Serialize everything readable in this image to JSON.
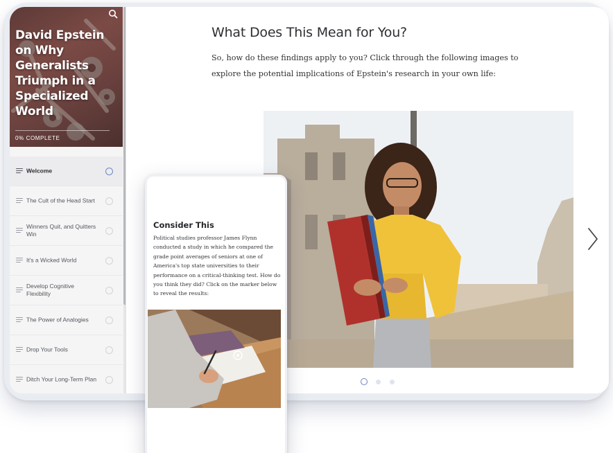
{
  "course": {
    "title": "David Epstein on Why Generalists Triumph in a Specialized World",
    "progress_label": "0% COMPLETE"
  },
  "sidebar": {
    "items": [
      {
        "label": "Welcome",
        "active": true
      },
      {
        "label": "The Cult of the Head Start",
        "active": false
      },
      {
        "label": "Winners Quit, and Quitters Win",
        "active": false
      },
      {
        "label": "It's a Wicked World",
        "active": false
      },
      {
        "label": "Develop Cognitive Flexibility",
        "active": false
      },
      {
        "label": "The Power of Analogies",
        "active": false
      },
      {
        "label": "Drop Your Tools",
        "active": false
      },
      {
        "label": "Ditch Your Long-Term Plan",
        "active": false
      }
    ]
  },
  "lesson": {
    "title": "What Does This Mean for You?",
    "body": "So, how do these findings apply to you? Click through the following images to explore the potential implications of Epstein's research in your own life:"
  },
  "carousel": {
    "slide_count": 3,
    "active_index": 0
  },
  "phone": {
    "title": "Consider This",
    "body": "Political studies professor James Flynn conducted a study in which he compared the grade point averages of seniors at one of America's top state universities to their performance on a critical-thinking test. How do you think they did? Click on the marker below to reveal the results:"
  },
  "icons": {
    "search": "search-icon",
    "next": "chevron-right-icon",
    "lesson": "lines-icon",
    "status": "circle-icon",
    "marker": "marker-icon"
  },
  "colors": {
    "accent": "#6c83c5",
    "hero": "#6c423f"
  }
}
